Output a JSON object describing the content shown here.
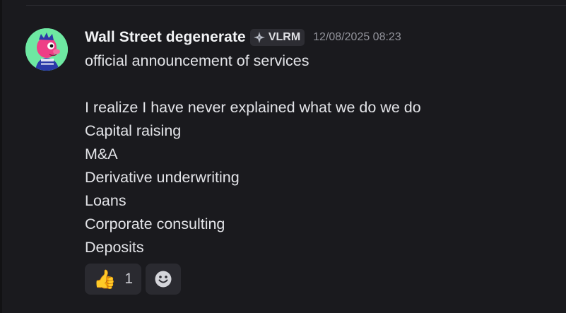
{
  "message": {
    "author": "Wall Street degenerate",
    "role_tag": "VLRM",
    "timestamp": "12/08/2025 08:23",
    "lines": [
      "official announcement of services",
      "",
      "I realize I have never explained what we do we do",
      "Capital raising",
      "M&A",
      "Derivative underwriting",
      "Loans",
      "Corporate consulting",
      "Deposits"
    ],
    "reactions": [
      {
        "emoji": "👍",
        "emoji_name": "thumbs-up",
        "count": "1"
      }
    ],
    "add_reaction_icon": "smiley-face-icon"
  },
  "colors": {
    "background": "#1a1a1e",
    "avatar_background": "#6ee8a2",
    "username": "#f2f3f5",
    "timestamp": "#92939b",
    "body_text": "#e3e4e8",
    "reaction_background": "#2a2a30"
  }
}
